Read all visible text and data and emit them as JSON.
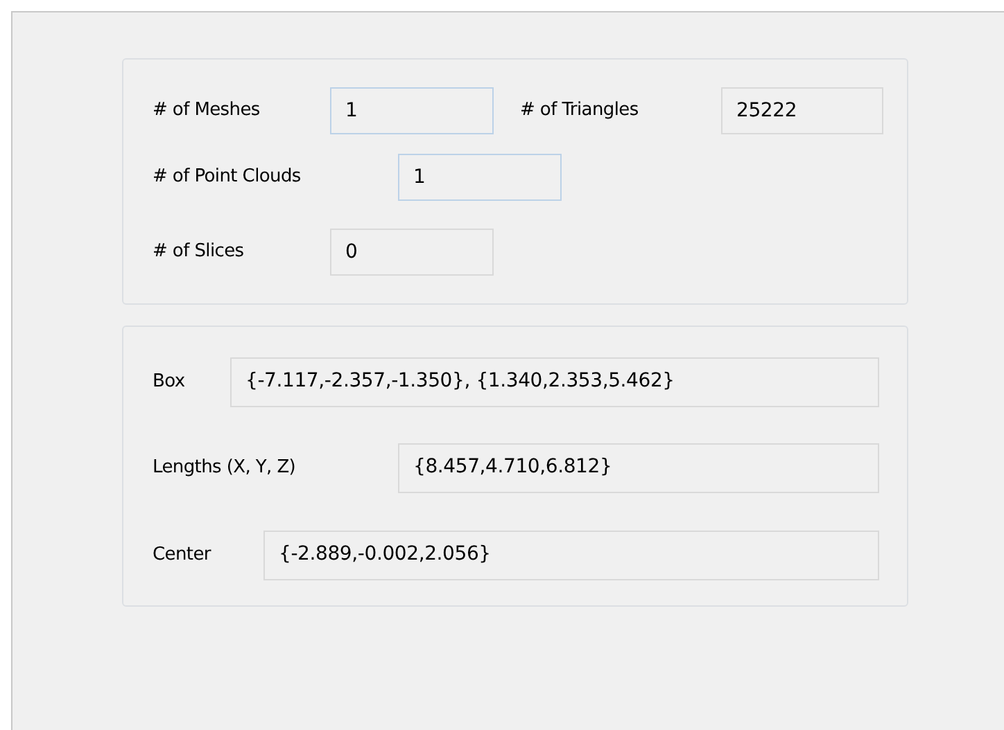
{
  "counts_panel": {
    "rows": [
      {
        "fields": [
          {
            "label": "# of Meshes",
            "value": "1",
            "editable": true
          },
          {
            "label": "# of Triangles",
            "value": "25222",
            "editable": false
          }
        ]
      },
      {
        "fields": [
          {
            "label": "# of Point Clouds",
            "value": "1",
            "editable": true
          }
        ]
      },
      {
        "fields": [
          {
            "label": "# of Slices",
            "value": "0",
            "editable": false
          }
        ]
      }
    ]
  },
  "bounds_panel": {
    "rows": [
      {
        "label": "Box",
        "value": "{-7.117,-2.357,-1.350}, {1.340,2.353,5.462}"
      },
      {
        "label": "Lengths (X, Y, Z)",
        "value": "{8.457,4.710,6.812}"
      },
      {
        "label": "Center",
        "value": "{-2.889,-0.002,2.056}"
      }
    ]
  }
}
